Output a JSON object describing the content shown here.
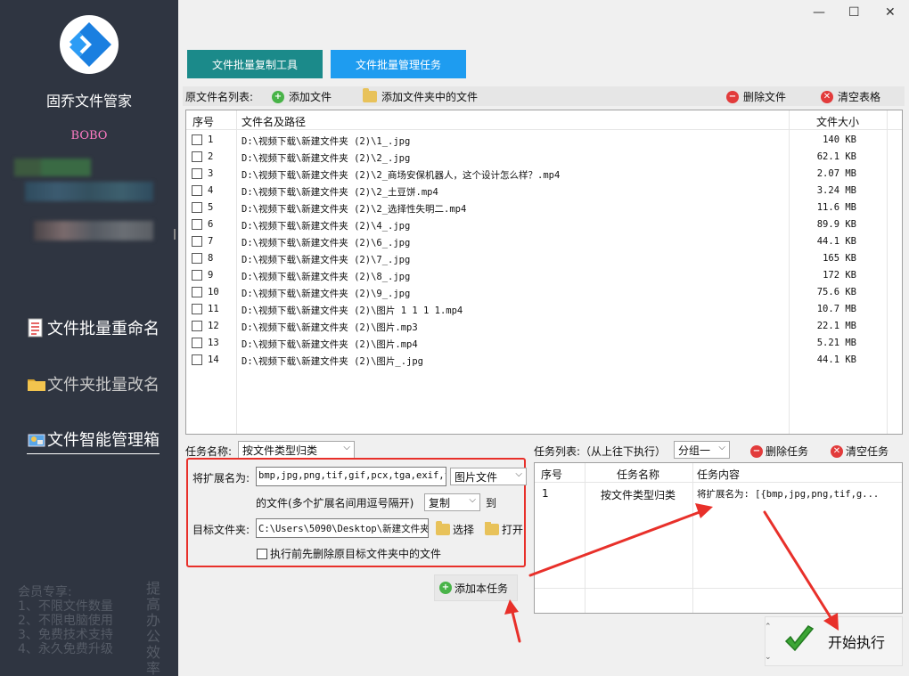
{
  "app": {
    "title": "固乔文件管家",
    "user": "BOBO"
  },
  "window": {
    "minimize": "—",
    "maximize": "☐",
    "close": "✕"
  },
  "sidebar": {
    "nav": [
      {
        "label": "文件批量重命名",
        "icon": "document-icon"
      },
      {
        "label": "文件夹批量改名",
        "icon": "folder-icon"
      },
      {
        "label": "文件智能管理箱",
        "icon": "toolbox-icon"
      }
    ],
    "member_title": "会员专享:",
    "member_lines": [
      "1、不限文件数量",
      "2、不限电脑使用",
      "3、免费技术支持",
      "4、永久免费升级"
    ],
    "slogan": "提高办公效率"
  },
  "tabs": [
    {
      "label": "文件批量复制工具",
      "color": "#1b8a8a"
    },
    {
      "label": "文件批量管理任务",
      "color": "#1e9cf0"
    }
  ],
  "toolbar": {
    "list_label": "原文件名列表:",
    "add_file": "添加文件",
    "add_folder": "添加文件夹中的文件",
    "delete_file": "删除文件",
    "clear_table": "清空表格"
  },
  "file_table": {
    "headers": {
      "seq": "序号",
      "path": "文件名及路径",
      "size": "文件大小"
    },
    "rows": [
      {
        "seq": "1",
        "path": "D:\\视频下载\\新建文件夹 (2)\\1_.jpg",
        "size": "140 KB"
      },
      {
        "seq": "2",
        "path": "D:\\视频下载\\新建文件夹 (2)\\2_.jpg",
        "size": "62.1 KB"
      },
      {
        "seq": "3",
        "path": "D:\\视频下载\\新建文件夹 (2)\\2_商场安保机器人，这个设计怎么样？.mp4",
        "size": "2.07 MB"
      },
      {
        "seq": "4",
        "path": "D:\\视频下载\\新建文件夹 (2)\\2_土豆饼.mp4",
        "size": "3.24 MB"
      },
      {
        "seq": "5",
        "path": "D:\\视频下载\\新建文件夹 (2)\\2_选择性失明二.mp4",
        "size": "11.6 MB"
      },
      {
        "seq": "6",
        "path": "D:\\视频下载\\新建文件夹 (2)\\4_.jpg",
        "size": "89.9 KB"
      },
      {
        "seq": "7",
        "path": "D:\\视频下载\\新建文件夹 (2)\\6_.jpg",
        "size": "44.1 KB"
      },
      {
        "seq": "8",
        "path": "D:\\视频下载\\新建文件夹 (2)\\7_.jpg",
        "size": "165 KB"
      },
      {
        "seq": "9",
        "path": "D:\\视频下载\\新建文件夹 (2)\\8_.jpg",
        "size": "172 KB"
      },
      {
        "seq": "10",
        "path": "D:\\视频下载\\新建文件夹 (2)\\9_.jpg",
        "size": "75.6 KB"
      },
      {
        "seq": "11",
        "path": "D:\\视频下载\\新建文件夹 (2)\\图片 1 1 1 1.mp4",
        "size": "10.7 MB"
      },
      {
        "seq": "12",
        "path": "D:\\视频下载\\新建文件夹 (2)\\图片.mp3",
        "size": "22.1 MB"
      },
      {
        "seq": "13",
        "path": "D:\\视频下载\\新建文件夹 (2)\\图片.mp4",
        "size": "5.21 MB"
      },
      {
        "seq": "14",
        "path": "D:\\视频下载\\新建文件夹 (2)\\图片_.jpg",
        "size": "44.1 KB"
      }
    ]
  },
  "task_config": {
    "name_label": "任务名称:",
    "name_value": "按文件类型归类",
    "ext_label": "将扩展名为:",
    "ext_value": "bmp,jpg,png,tif,gif,pcx,tga,exif,fp",
    "file_type": "图片文件",
    "desc": "的文件(多个扩展名间用逗号隔开)",
    "action": "复制",
    "to": "到",
    "target_label": "目标文件夹:",
    "target_value": "C:\\Users\\5090\\Desktop\\新建文件夹",
    "choose": "选择",
    "open": "打开",
    "delete_before": "执行前先删除原目标文件夹中的文件",
    "add_task": "添加本任务"
  },
  "task_list": {
    "label": "任务列表:（从上往下执行）",
    "group": "分组一",
    "delete_task": "删除任务",
    "clear_task": "清空任务",
    "headers": {
      "seq": "序号",
      "name": "任务名称",
      "content": "任务内容"
    },
    "rows": [
      {
        "seq": "1",
        "name": "按文件类型归类",
        "content": "将扩展名为: [{bmp,jpg,png,tif,g..."
      }
    ]
  },
  "start": "开始执行",
  "colors": {
    "sidebar": "#2f3541",
    "arrow": "#e8302a",
    "accent": "#1e9cf0"
  }
}
